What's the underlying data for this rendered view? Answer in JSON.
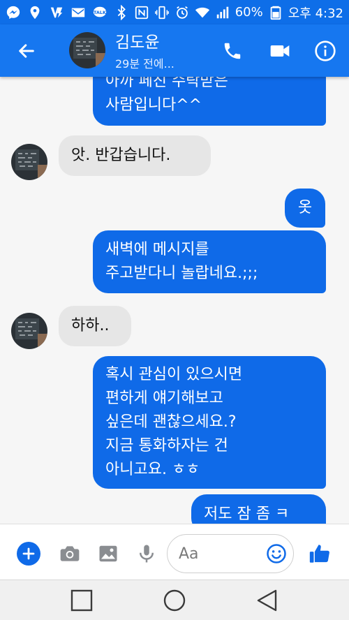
{
  "status_bar": {
    "battery": "60%",
    "time": "오후 4:32",
    "icons": [
      "messenger-icon",
      "location-icon",
      "vpn-icon",
      "gmail-icon",
      "kakaotalk-icon",
      "bluetooth-icon",
      "nfc-icon",
      "vibrate-icon",
      "alarm-icon",
      "wifi-icon",
      "signal-icon",
      "battery-icon"
    ]
  },
  "header": {
    "name": "김도윤",
    "subtitle": "29분 전에...",
    "accent_color": "#1677f0"
  },
  "messages": [
    {
      "from": "me",
      "text": "아까 페친 수락받은\n사람입니다^^"
    },
    {
      "from": "other",
      "text": "앗. 반갑습니다."
    },
    {
      "from": "me",
      "text": "옷"
    },
    {
      "from": "me",
      "text": "새벽에 메시지를\n주고받다니 놀랍네요.;;;"
    },
    {
      "from": "other",
      "text": "하하.."
    },
    {
      "from": "me",
      "text": "혹시 관심이 있으시면\n편하게 얘기해보고\n싶은데 괜찮으세요.?\n지금  통화하자는 건\n아니고요. ㅎㅎ"
    },
    {
      "from": "me",
      "text": "저도 잠 좀 ㅋ"
    }
  ],
  "composer": {
    "placeholder": "Aa",
    "icons": [
      "plus-icon",
      "camera-icon",
      "gallery-icon",
      "mic-icon",
      "emoji-icon",
      "thumbs-up-icon"
    ]
  },
  "colors": {
    "bubble_out": "#0f6ae8",
    "bubble_in": "#e6e6e6",
    "status_bar": "#0e6ee8"
  }
}
